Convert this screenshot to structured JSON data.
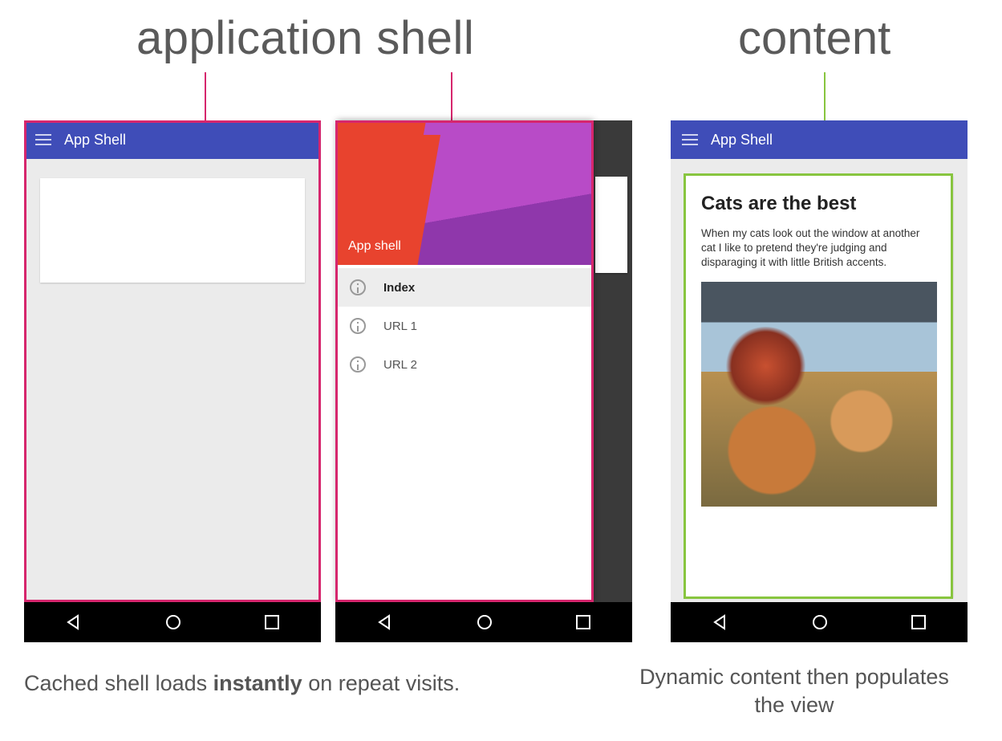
{
  "labels": {
    "app_shell": "application shell",
    "content": "content"
  },
  "colors": {
    "highlight_pink": "#d6266d",
    "highlight_green": "#88c53f",
    "appbar_blue": "#3f4db8"
  },
  "appbar": {
    "title": "App Shell"
  },
  "drawer": {
    "header_title": "App shell",
    "items": [
      {
        "label": "Index",
        "selected": true
      },
      {
        "label": "URL 1",
        "selected": false
      },
      {
        "label": "URL 2",
        "selected": false
      }
    ]
  },
  "content_card": {
    "title": "Cats are the best",
    "body": "When my cats look out the window at another cat I like to pretend they're judging and disparaging it with little British accents."
  },
  "captions": {
    "left_pre": "Cached shell loads ",
    "left_bold": "instantly",
    "left_post": " on repeat visits.",
    "right": "Dynamic content then populates the view"
  }
}
